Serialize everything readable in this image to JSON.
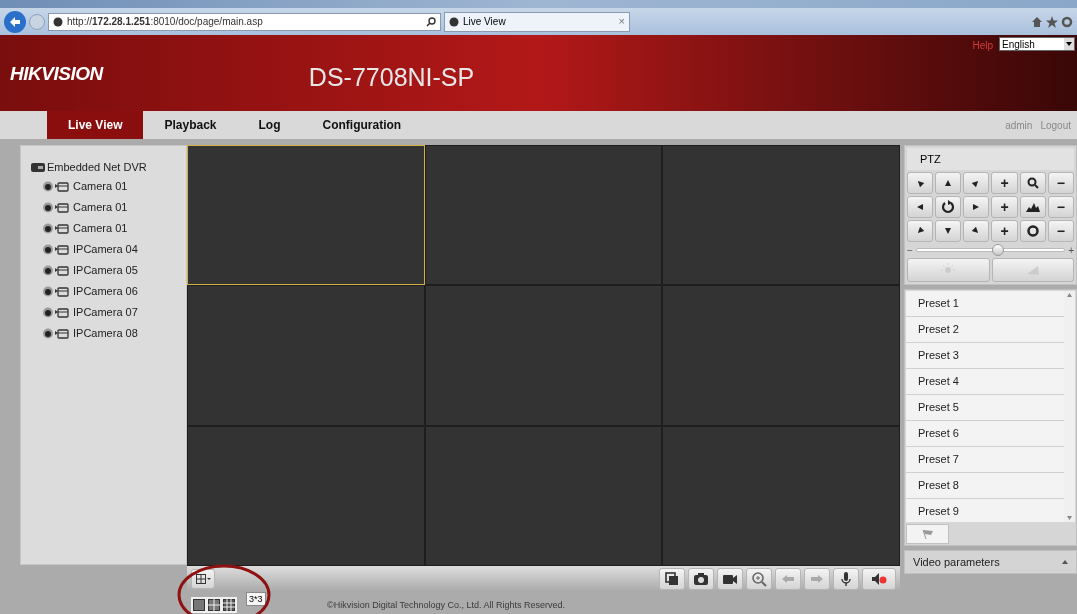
{
  "browser": {
    "url": "http://**172.28.1.251**:8010/doc/page/main.asp",
    "tab_title": "Live View",
    "tab_close": "×"
  },
  "header": {
    "logo": "HIKVISION",
    "model": "DS-7708NI-SP",
    "help": "Help",
    "language": "English"
  },
  "nav": {
    "tabs": [
      {
        "label": "Live View",
        "selected": true
      },
      {
        "label": "Playback",
        "selected": false
      },
      {
        "label": "Log",
        "selected": false
      },
      {
        "label": "Configuration",
        "selected": false
      }
    ],
    "user": "admin",
    "logout": "Logout"
  },
  "tree": {
    "label": "Embedded Net DVR",
    "children": [
      {
        "label": "Camera 01"
      },
      {
        "label": "Camera 01"
      },
      {
        "label": "Camera 01"
      },
      {
        "label": "IPCamera 04"
      },
      {
        "label": "IPCamera 05"
      },
      {
        "label": "IPCamera 06"
      },
      {
        "label": "IPCamera 07"
      },
      {
        "label": "IPCamera 08"
      }
    ]
  },
  "video_grid": [
    {
      "selected": true
    },
    {
      "selected": false
    },
    {
      "selected": false
    },
    {
      "selected": false
    },
    {
      "selected": false
    },
    {
      "selected": false
    },
    {
      "selected": false
    },
    {
      "selected": false
    },
    {
      "selected": false
    }
  ],
  "ptz": {
    "title": "PTZ",
    "buttons": [
      {
        "kind": "arrow"
      },
      {
        "kind": "arrow"
      },
      {
        "kind": "arrow"
      },
      {
        "kind": "text",
        "text": "+"
      },
      {
        "kind": "icon"
      },
      {
        "kind": "text",
        "text": "−"
      },
      {
        "kind": "arrow"
      },
      {
        "kind": "icon"
      },
      {
        "kind": "arrow"
      },
      {
        "kind": "text",
        "text": "+"
      },
      {
        "kind": "icon"
      },
      {
        "kind": "text",
        "text": "−"
      },
      {
        "kind": "arrow"
      },
      {
        "kind": "arrow"
      },
      {
        "kind": "arrow"
      },
      {
        "kind": "text",
        "text": "+"
      },
      {
        "kind": "icon"
      },
      {
        "kind": "text",
        "text": "−"
      }
    ],
    "speed": {
      "minus": "−",
      "plus": "+",
      "level": 0.55
    }
  },
  "presets": [
    "Preset 1",
    "Preset 2",
    "Preset 3",
    "Preset 4",
    "Preset 5",
    "Preset 6",
    "Preset 7",
    "Preset 8",
    "Preset 9"
  ],
  "video_parameters": "Video parameters",
  "layout_tooltip": "3*3",
  "footer": "©Hikvision Digital Technology Co., Ltd. All Rights Reserved."
}
